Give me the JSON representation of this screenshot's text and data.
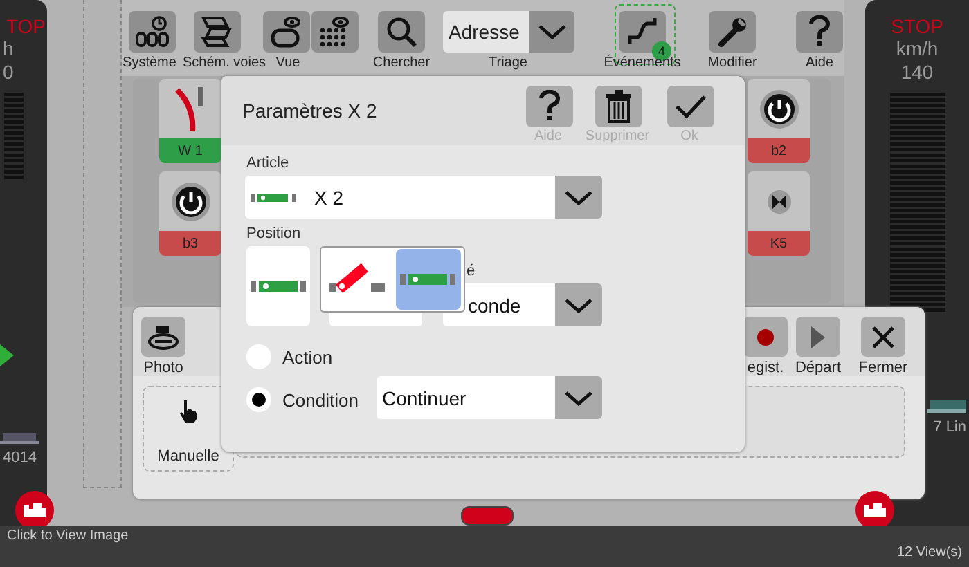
{
  "left_throttle": {
    "stop": "TOP",
    "unit": "h",
    "speed": "0",
    "loco_name": "4014"
  },
  "right_throttle": {
    "stop": "STOP",
    "unit": "km/h",
    "speed": "140",
    "loco_name": "7 Lin"
  },
  "toolbar": {
    "items": [
      {
        "label": "Système",
        "kind": "system"
      },
      {
        "label": "Schém. voies",
        "kind": "layout"
      },
      {
        "label": "Vue",
        "kind": "view"
      },
      {
        "label": "Chercher",
        "kind": "search"
      }
    ],
    "address": {
      "value": "Adresse",
      "label": "Triage"
    },
    "right_items": [
      {
        "label": "Événements",
        "kind": "events",
        "badge": "4",
        "selected": true
      },
      {
        "label": "Modifier",
        "kind": "edit",
        "selected": false
      },
      {
        "label": "Aide",
        "kind": "help",
        "selected": false
      }
    ]
  },
  "keyboard_tiles": [
    {
      "label": "W 1",
      "kind": "turnout",
      "color": "#2e9e48"
    },
    {
      "label": "b3",
      "kind": "power",
      "color": "#c84b4b"
    },
    {
      "label": "b2",
      "kind": "power",
      "color": "#c84b4b"
    },
    {
      "label": "K5",
      "kind": "uncoupler",
      "color": "#c84b4b"
    }
  ],
  "event_window": {
    "toolbar": [
      {
        "label": "Photo",
        "kind": "photo"
      },
      {
        "label": "egist.",
        "kind": "record"
      },
      {
        "label": "Départ",
        "kind": "start"
      },
      {
        "label": "Fermer",
        "kind": "close"
      }
    ],
    "tile": {
      "label": "Manuelle"
    }
  },
  "dialog": {
    "title": "Paramètres X 2",
    "buttons": [
      {
        "label": "Aide",
        "kind": "help",
        "disabled": true
      },
      {
        "label": "Supprimer",
        "kind": "delete",
        "disabled": true
      },
      {
        "label": "Ok",
        "kind": "ok",
        "disabled": true
      }
    ],
    "article": {
      "label": "Article",
      "value": "X 2"
    },
    "position": {
      "label": "Position",
      "options": [
        {
          "kind": "diverge",
          "selected": false
        },
        {
          "kind": "straight",
          "selected": true
        }
      ]
    },
    "partial_label": "é",
    "delay_value": "conde",
    "modes": [
      {
        "label": "Action",
        "selected": false
      },
      {
        "label": "Condition",
        "selected": true
      }
    ],
    "condition_value": "Continuer"
  },
  "footer": {
    "caption": "Click to View Image",
    "views": "12 View(s)"
  }
}
